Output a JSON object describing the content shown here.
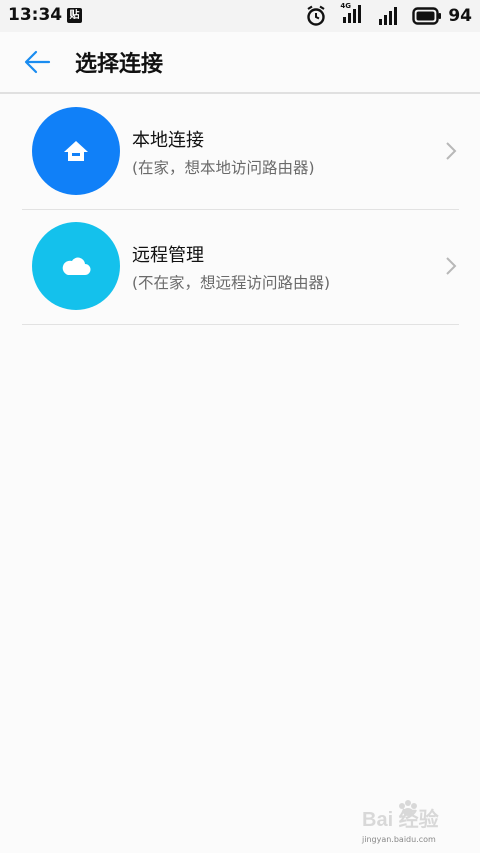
{
  "status_bar": {
    "time": "13:34",
    "app_badge": "贴",
    "network": "4G",
    "battery": "94"
  },
  "header": {
    "title": "选择连接"
  },
  "options": [
    {
      "title": "本地连接",
      "subtitle": "(在家，想本地访问路由器)",
      "icon": "home-icon",
      "color": "#1080f8"
    },
    {
      "title": "远程管理",
      "subtitle": "(不在家，想远程访问路由器)",
      "icon": "cloud-icon",
      "color": "#14c1ec"
    }
  ],
  "watermark": {
    "brand": "Bai 经验",
    "url": "jingyan.baidu.com"
  }
}
